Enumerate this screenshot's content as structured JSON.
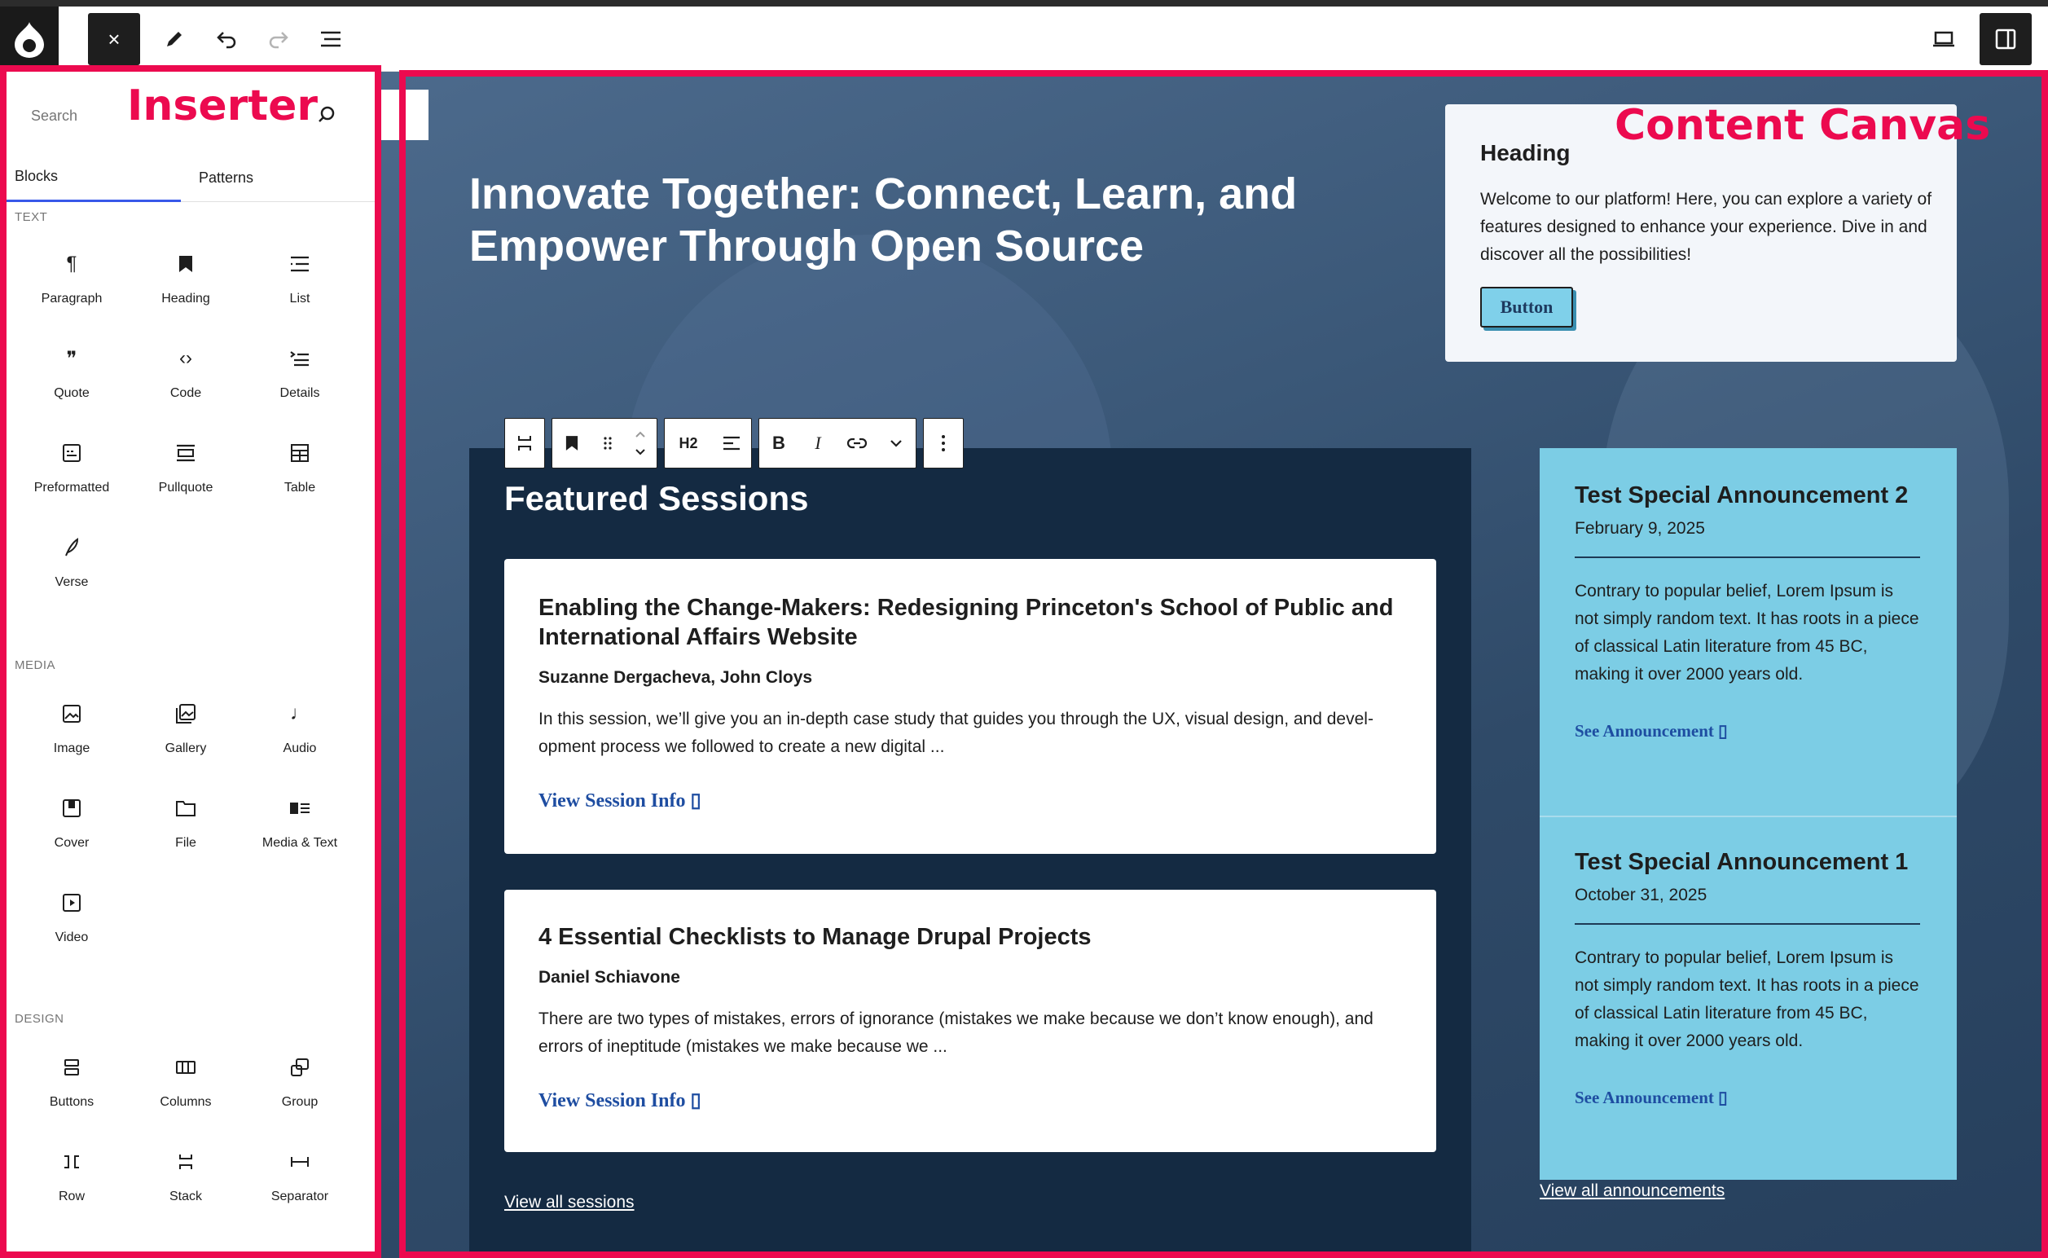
{
  "toolbar": {
    "close_label": "×",
    "icons": [
      "drupal-logo",
      "close-icon",
      "pencil-icon",
      "undo-icon",
      "redo-icon",
      "list-view-icon",
      "desktop-preview-icon",
      "sidebar-toggle-icon"
    ]
  },
  "inserter": {
    "search_placeholder": "Search",
    "tabs": [
      {
        "label": "Blocks"
      },
      {
        "label": "Patterns"
      }
    ],
    "categories": [
      {
        "title": "TEXT",
        "blocks": [
          {
            "label": "Paragraph",
            "icon": "¶"
          },
          {
            "label": "Heading",
            "icon": "bookmark"
          },
          {
            "label": "List",
            "icon": "list"
          },
          {
            "label": "Quote",
            "icon": "❞"
          },
          {
            "label": "Code",
            "icon": "‹›"
          },
          {
            "label": "Details",
            "icon": "details"
          },
          {
            "label": "Preformatted",
            "icon": "preformatted"
          },
          {
            "label": "Pullquote",
            "icon": "pullquote"
          },
          {
            "label": "Table",
            "icon": "table"
          },
          {
            "label": "Verse",
            "icon": "verse"
          }
        ]
      },
      {
        "title": "MEDIA",
        "blocks": [
          {
            "label": "Image",
            "icon": "image"
          },
          {
            "label": "Gallery",
            "icon": "gallery"
          },
          {
            "label": "Audio",
            "icon": "♩"
          },
          {
            "label": "Cover",
            "icon": "cover"
          },
          {
            "label": "File",
            "icon": "folder"
          },
          {
            "label": "Media & Text",
            "icon": "media-text"
          },
          {
            "label": "Video",
            "icon": "video"
          }
        ]
      },
      {
        "title": "DESIGN",
        "blocks": [
          {
            "label": "Buttons",
            "icon": "buttons"
          },
          {
            "label": "Columns",
            "icon": "columns"
          },
          {
            "label": "Group",
            "icon": "group"
          },
          {
            "label": "Row",
            "icon": "row"
          },
          {
            "label": "Stack",
            "icon": "stack"
          },
          {
            "label": "Separator",
            "icon": "separator"
          }
        ]
      }
    ]
  },
  "canvas": {
    "hero_title": "Innovate Together: Connect, Learn, and Empower Through Open Source",
    "info_card": {
      "heading": "Heading",
      "text": "Welcome to our platform! Here, you can explore a variety of features designed to enhance your experience. Dive in and discover all the possibilities!",
      "button": "Button"
    },
    "block_toolbar": {
      "heading_level": "H2",
      "bold": "B",
      "italic": "I"
    },
    "featured_title": "Featured Sessions",
    "sessions": [
      {
        "title": "Enabling the Change-Makers: Redesigning Princeton's School of Public and International Affairs Website",
        "authors": "Suzanne Dergacheva, John Cloys",
        "description": "In this session, we’ll give you an in-depth case study that guides you through the UX, visual design, and devel-opment process we followed to create a new digital ...",
        "link": "View Session Info ▯"
      },
      {
        "title": "4 Essential Checklists to Manage Drupal Projects",
        "authors": "Daniel Schiavone",
        "description": "There are two types of mistakes, errors of ignorance (mistakes we make because we don’t know enough), and errors of ineptitude (mistakes we make because we ...",
        "link": "View Session Info ▯"
      }
    ],
    "view_all_sessions": "View all sessions",
    "announcements": [
      {
        "title": "Test Special Announcement 2",
        "date": "February 9, 2025",
        "text": "Contrary to popular belief, Lorem Ipsum is not simply random text. It has roots in a piece of classical Latin literature from 45 BC, making it over 2000 years old.",
        "link": "See Announcement ▯"
      },
      {
        "title": "Test Special Announcement 1",
        "date": "October 31, 2025",
        "text": "Contrary to popular belief, Lorem Ipsum is not simply random text. It has roots in a piece of classical Latin literature from 45 BC, making it over 2000 years old.",
        "link": "See Announcement ▯"
      }
    ],
    "view_all_announcements": "View all announcements"
  },
  "annotations": {
    "inserter": "Inserter",
    "canvas": "Content Canvas"
  },
  "colors": {
    "annotation": "#ec0a4f",
    "announcement_bg": "#7ccde5",
    "featured_bg": "#142a42",
    "link": "#1e4da1",
    "accent": "#3858e9"
  }
}
